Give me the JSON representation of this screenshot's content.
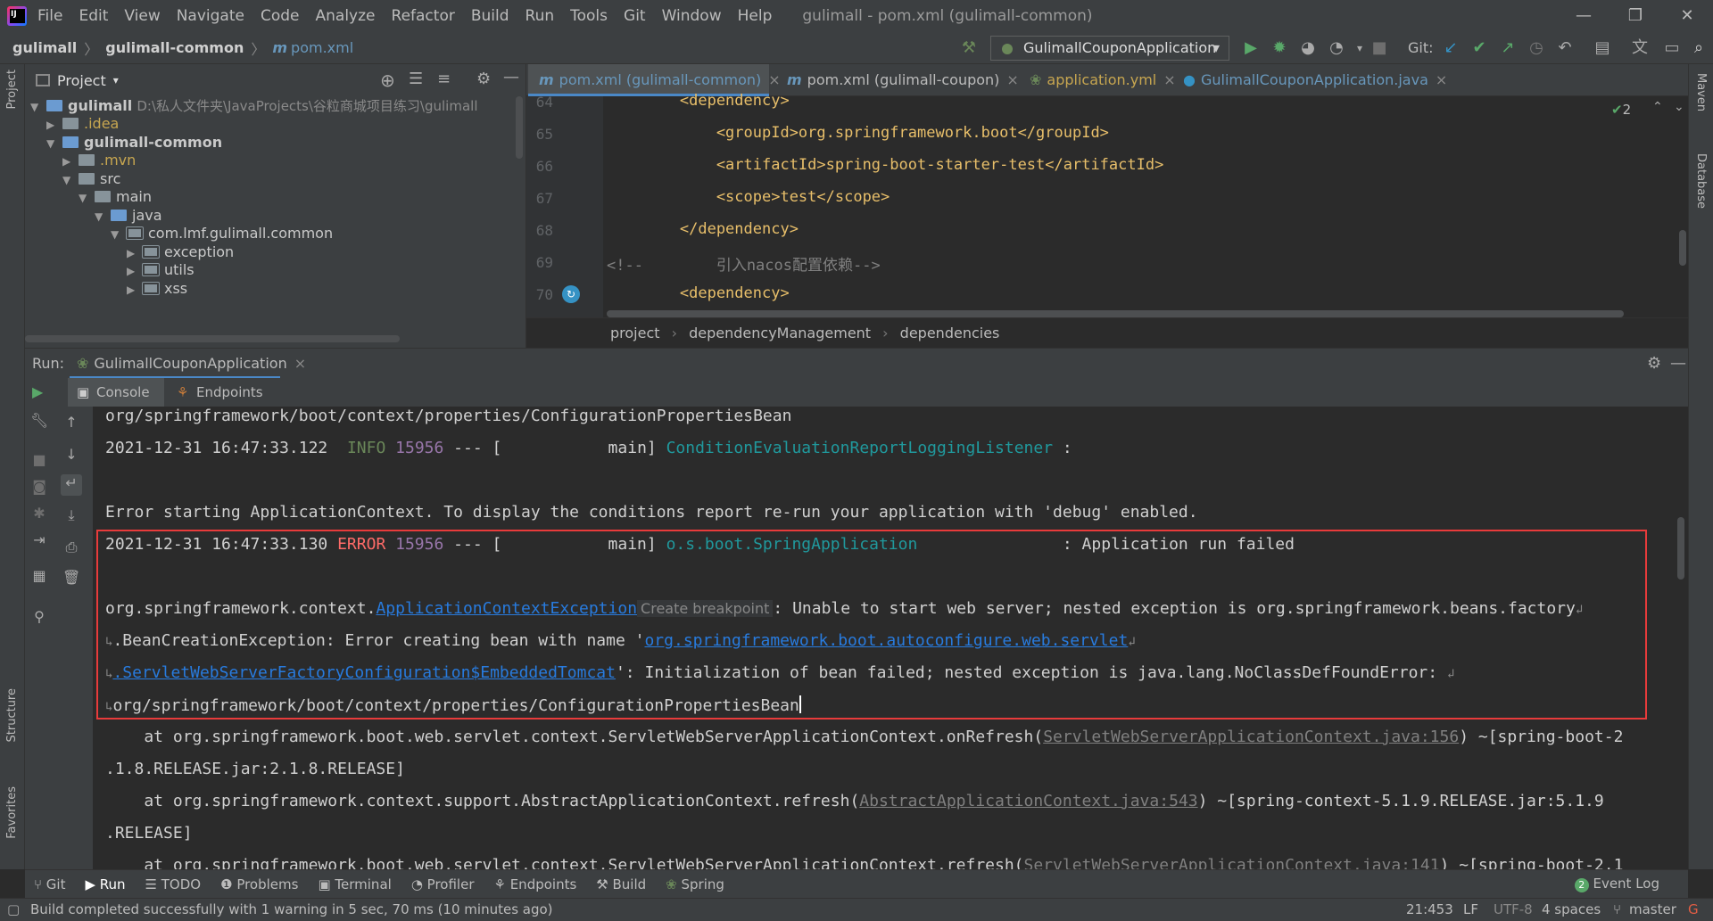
{
  "menubar": {
    "items": [
      "File",
      "Edit",
      "View",
      "Navigate",
      "Code",
      "Analyze",
      "Refactor",
      "Build",
      "Run",
      "Tools",
      "Git",
      "Window",
      "Help"
    ],
    "window_title": "gulimall - pom.xml (gulimall-common)",
    "minimize": "—",
    "restore": "❐",
    "close": "✕"
  },
  "navbar": {
    "root": "gulimall",
    "module": "gulimall-common",
    "file_icon": "m",
    "file": "pom.xml",
    "run_config": "GulimallCouponApplication",
    "git_label": "Git:"
  },
  "strips": {
    "project": "Project",
    "structure": "Structure",
    "favorites": "Favorites",
    "maven": "Maven",
    "database": "Database"
  },
  "project": {
    "title": "Project",
    "tree": [
      {
        "label": "gulimall",
        "extra": "D:\\私人文件夹\\JavaProjects\\谷粒商城项目练习\\gulimall",
        "expanded": true
      },
      {
        "label": ".idea",
        "expanded": false
      },
      {
        "label": "gulimall-common",
        "expanded": true
      },
      {
        "label": ".mvn",
        "expanded": false
      },
      {
        "label": "src",
        "expanded": true
      },
      {
        "label": "main",
        "expanded": true
      },
      {
        "label": "java",
        "expanded": true
      },
      {
        "label": "com.lmf.gulimall.common",
        "expanded": true
      },
      {
        "label": "exception",
        "expanded": false
      },
      {
        "label": "utils",
        "expanded": false
      },
      {
        "label": "xss",
        "expanded": false
      }
    ]
  },
  "editor": {
    "tabs": [
      {
        "label": "pom.xml (gulimall-common)",
        "icon": "m",
        "active": true
      },
      {
        "label": "pom.xml (gulimall-coupon)",
        "icon": "m",
        "active": false
      },
      {
        "label": "application.yml",
        "icon": "yml",
        "active": false
      },
      {
        "label": "GulimallCouponApplication.java",
        "icon": "c",
        "active": false
      }
    ],
    "inspection_count": "2",
    "lines": [
      {
        "n": "64",
        "text": "        <dependency>"
      },
      {
        "n": "65",
        "text": "            <groupId>org.springframework.boot</groupId>"
      },
      {
        "n": "66",
        "text": "            <artifactId>spring-boot-starter-test</artifactId>"
      },
      {
        "n": "67",
        "text": "            <scope>test</scope>"
      },
      {
        "n": "68",
        "text": "        </dependency>"
      },
      {
        "n": "69",
        "text": "<!--        引入nacos配置依赖-->"
      },
      {
        "n": "70",
        "text": "        <dependency>"
      }
    ],
    "breadcrumbs": [
      "project",
      "dependencyManagement",
      "dependencies"
    ]
  },
  "run": {
    "label": "Run:",
    "tab": "GulimallCouponApplication",
    "subtabs": [
      "Console",
      "Endpoints"
    ]
  },
  "console": {
    "lines": [
      "org/springframework/boot/context/properties/ConfigurationPropertiesBean",
      {
        "ts": "2021-12-31 16:47:33.122",
        "level": "INFO",
        "pid": "15956",
        "mid": " --- [           main] ",
        "logger": "ConditionEvaluationReportLoggingListener",
        "tail": " :"
      },
      "",
      "Error starting ApplicationContext. To display the conditions report re-run your application with 'debug' enabled.",
      {
        "ts": "2021-12-31 16:47:33.130",
        "level": "ERROR",
        "pid": "15956",
        "mid": " --- [           main] ",
        "logger": "o.s.boot.SpringApplication",
        "tail": "               : Application run failed"
      },
      "",
      {
        "pre": "org.springframework.context.",
        "link": "ApplicationContextException",
        "hint": "Create breakpoint",
        "post": ": Unable to start web server; nested exception is org.springframework.beans.factory"
      },
      {
        "pre": ".BeanCreationException: Error creating bean with name '",
        "link": "org.springframework.boot.autoconfigure.web.servlet",
        "post": ""
      },
      {
        "pre": "",
        "link": ".ServletWebServerFactoryConfiguration$EmbeddedTomcat",
        "post": "': Initialization of bean failed; nested exception is java.lang.NoClassDefFoundError: "
      },
      "org/springframework/boot/context/properties/ConfigurationPropertiesBean",
      {
        "pre": "    at org.springframework.boot.web.servlet.context.ServletWebServerApplicationContext.onRefresh(",
        "glink": "ServletWebServerApplicationContext.java:156",
        "post": ") ~[spring-boot-2"
      },
      ".1.8.RELEASE.jar:2.1.8.RELEASE]",
      {
        "pre": "    at org.springframework.context.support.AbstractApplicationContext.refresh(",
        "glink": "AbstractApplicationContext.java:543",
        "post": ") ~[spring-context-5.1.9.RELEASE.jar:5.1.9"
      },
      ".RELEASE]",
      {
        "pre": "    at org.springframework.boot.web.servlet.context.ServletWebServerApplicationContext.refresh(",
        "glink": "ServletWebServerApplicationContext.java:141",
        "post": ") ~[spring-boot-2.1"
      }
    ]
  },
  "toolwindows": [
    "Git",
    "Run",
    "TODO",
    "Problems",
    "Terminal",
    "Profiler",
    "Endpoints",
    "Build",
    "Spring"
  ],
  "event_log": {
    "count": "2",
    "label": "Event Log"
  },
  "status": {
    "message": "Build completed successfully with 1 warning in 5 sec, 70 ms (10 minutes ago)",
    "position": "21:453",
    "line_sep": "LF",
    "encoding": "UTF-8",
    "indent": "4 spaces",
    "branch": "master"
  },
  "colors": {
    "accent": "#4a88c7",
    "error_box": "#e83b3b",
    "bg": "#2b2b2b",
    "panel": "#3c3f41"
  }
}
